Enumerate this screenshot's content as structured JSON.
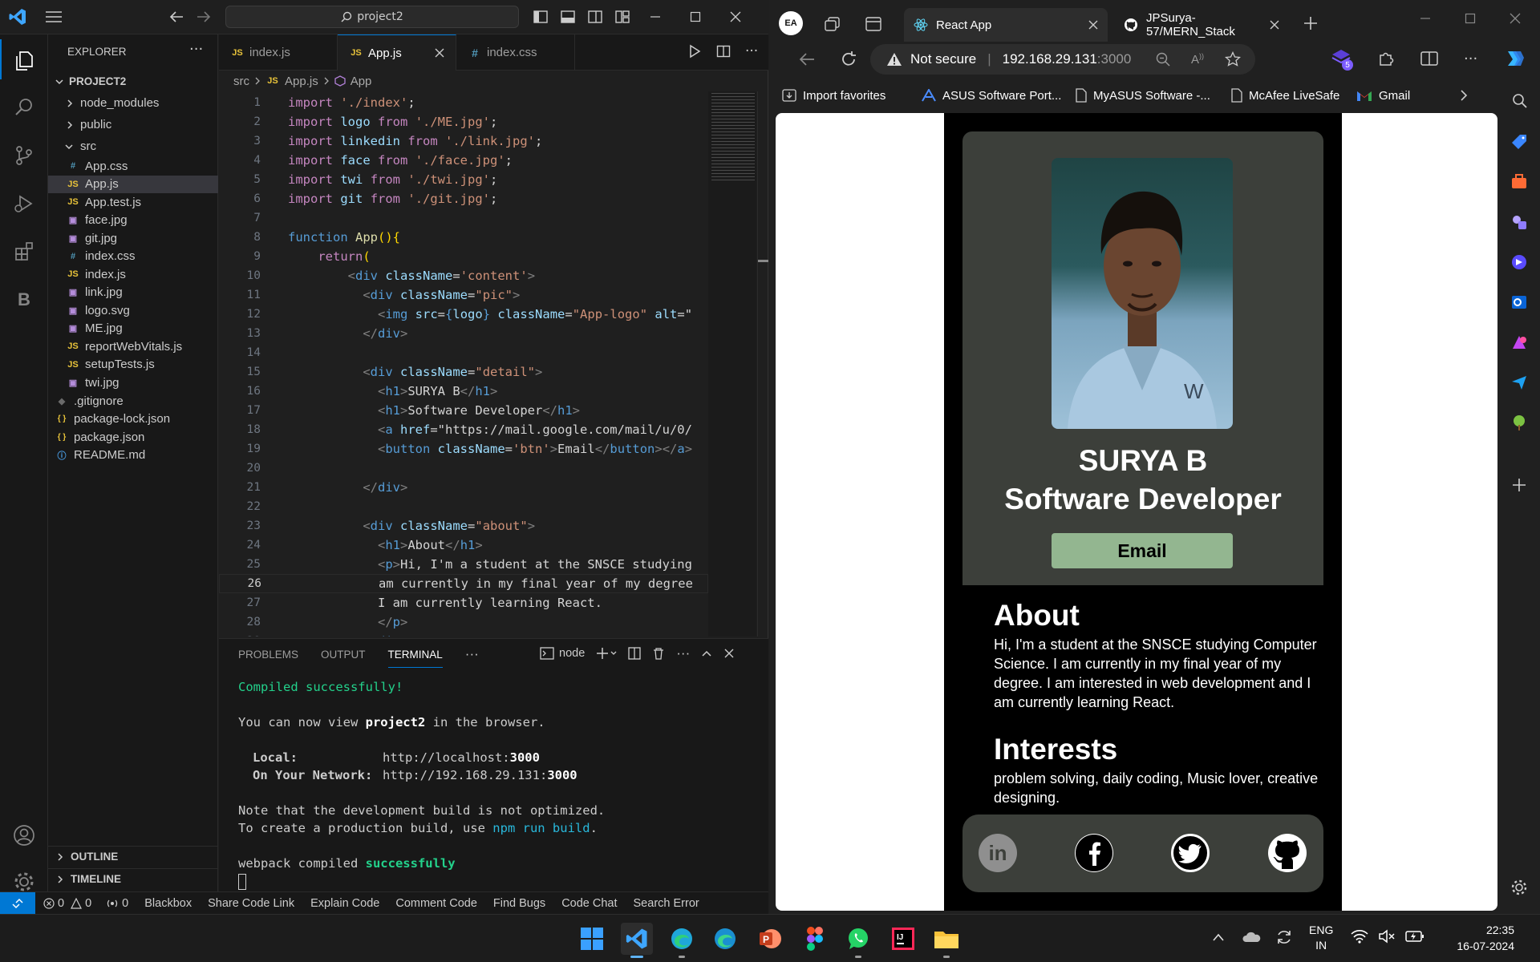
{
  "vscode": {
    "search": "project2",
    "explorer_title": "EXPLORER",
    "project": "PROJECT2",
    "folders": [
      "node_modules",
      "public",
      "src"
    ],
    "src_files": [
      {
        "name": "App.css",
        "kind": "css"
      },
      {
        "name": "App.js",
        "kind": "js"
      },
      {
        "name": "App.test.js",
        "kind": "js"
      },
      {
        "name": "face.jpg",
        "kind": "img"
      },
      {
        "name": "git.jpg",
        "kind": "img"
      },
      {
        "name": "index.css",
        "kind": "css"
      },
      {
        "name": "index.js",
        "kind": "js"
      },
      {
        "name": "link.jpg",
        "kind": "img"
      },
      {
        "name": "logo.svg",
        "kind": "img"
      },
      {
        "name": "ME.jpg",
        "kind": "img"
      },
      {
        "name": "reportWebVitals.js",
        "kind": "js"
      },
      {
        "name": "setupTests.js",
        "kind": "js"
      },
      {
        "name": "twi.jpg",
        "kind": "img"
      }
    ],
    "root_files": [
      {
        "name": ".gitignore",
        "kind": "git"
      },
      {
        "name": "package-lock.json",
        "kind": "json"
      },
      {
        "name": "package.json",
        "kind": "json"
      },
      {
        "name": "README.md",
        "kind": "info"
      }
    ],
    "outline": "OUTLINE",
    "timeline": "TIMELINE",
    "tabs": [
      "index.js",
      "App.js",
      "index.css"
    ],
    "breadcrumb": [
      "src",
      "App.js",
      "App"
    ],
    "code_lines": [
      "import './index';",
      "import logo from './ME.jpg';",
      "import linkedin from './link.jpg';",
      "import face from './face.jpg';",
      "import twi from './twi.jpg';",
      "import git from './git.jpg';",
      "",
      "function App(){",
      "    return(",
      "        <div className='content'>",
      "          <div className=\"pic\">",
      "            <img src={logo} className=\"App-logo\" alt=\"",
      "          </div>",
      "",
      "          <div className=\"detail\">",
      "            <h1>SURYA B</h1>",
      "            <h1>Software Developer</h1>",
      "            <a href=\"https://mail.google.com/mail/u/0/",
      "            <button className='btn'>Email</button></a>",
      "",
      "          </div>",
      "",
      "          <div className=\"about\">",
      "            <h1>About</h1>",
      "            <p>Hi, I'm a student at the SNSCE studying",
      "            am currently in my final year of my degree",
      "            I am currently learning React.",
      "            </p>",
      "          </div>"
    ],
    "current_line": 26,
    "panel_tabs": [
      "PROBLEMS",
      "OUTPUT",
      "TERMINAL"
    ],
    "terminal_shell": "node",
    "terminal": {
      "compiled": "Compiled successfully!",
      "view_pre": "You can now view ",
      "view_project": "project2",
      "view_post": " in the browser.",
      "local_label": "Local:",
      "local_url": "http://localhost:",
      "local_port": "3000",
      "net_label": "On Your Network:",
      "net_url": "http://192.168.29.131:",
      "net_port": "3000",
      "note1": "Note that the development build is not optimized.",
      "note2_pre": "To create a production build, use ",
      "note2_cmd": "npm run build",
      "note2_post": ".",
      "webpack_pre": "webpack compiled ",
      "webpack_ok": "successfully"
    },
    "status": {
      "errors": "0",
      "warnings": "0",
      "ports": "0",
      "items": [
        "Blackbox",
        "Share Code Link",
        "Explain Code",
        "Comment Code",
        "Find Bugs",
        "Code Chat",
        "Search Error"
      ]
    }
  },
  "browser": {
    "tabs": [
      "React App",
      "JPSurya-57/MERN_Stack"
    ],
    "not_secure": "Not secure",
    "url_host": "192.168.29.131",
    "url_port": ":3000",
    "favorites": [
      "Import favorites",
      "ASUS Software Port...",
      "MyASUS Software -...",
      "McAfee LiveSafe",
      "Gmail"
    ]
  },
  "portfolio": {
    "name": "SURYA B",
    "role": "Software Developer",
    "email_button": "Email",
    "about_title": "About",
    "about_text": "Hi, I'm a student at the SNSCE studying Computer Science. I am currently in my final year of my degree. I am interested in web development and I am currently learning React.",
    "interests_title": "Interests",
    "interests_text": "problem solving, daily coding, Music lover, creative designing.",
    "photo_text": "W"
  },
  "taskbar": {
    "lang1": "ENG",
    "lang2": "IN",
    "time": "22:35",
    "date": "16-07-2024"
  },
  "colors": {
    "vscode_bg": "#1f1f1f",
    "accent_blue": "#0078d4",
    "card_bg": "#3c3f3a",
    "email_btn": "#93b690",
    "term_green": "#23d18b"
  }
}
